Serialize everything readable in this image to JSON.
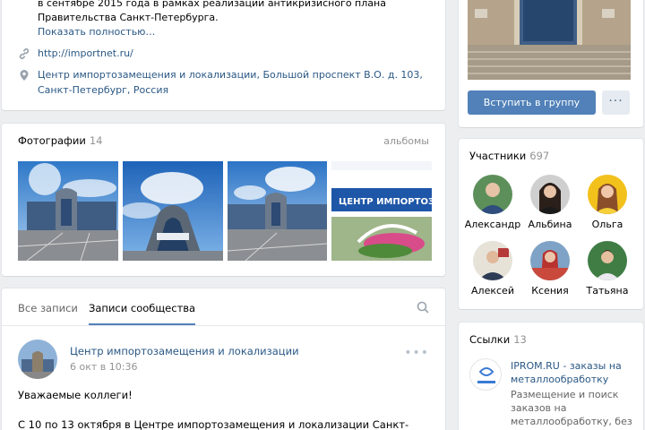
{
  "info": {
    "description_line1": "в сентябре 2015 года в рамках реализации антикризисного плана",
    "description_line2": "Правительства Санкт-Петербурга.",
    "show_more": "Показать полностью…",
    "website": "http://importnet.ru/",
    "address_line1": "Центр импортозамещения и локализации, Большой проспект В.О. д. 103,",
    "address_line2": "Санкт-Петербург, Россия"
  },
  "photos": {
    "title": "Фотографии",
    "count": "14",
    "albums_link": "альбомы",
    "banner_text": "ЦЕНТР ИМПОРТОЗАМЕЩЕНИЯ"
  },
  "feed": {
    "tab_all": "Все записи",
    "tab_community": "Записи сообщества",
    "post": {
      "author": "Центр импортозамещения и локализации",
      "date": "6 окт в 10:36",
      "line1": "Уважаемые коллеги!",
      "line2": "С 10 по 13 октября в Центре импортозамещения и локализации Санкт-"
    }
  },
  "group": {
    "join_button": "Вступить в группу",
    "more_button": "···"
  },
  "members": {
    "title": "Участники",
    "count": "697",
    "people": [
      {
        "name": "Александр"
      },
      {
        "name": "Альбина"
      },
      {
        "name": "Ольга"
      },
      {
        "name": "Алексей"
      },
      {
        "name": "Ксения"
      },
      {
        "name": "Татьяна"
      }
    ]
  },
  "links": {
    "title": "Ссылки",
    "count": "13",
    "item": {
      "title_line1": "IPROM.RU - заказы на",
      "title_line2": "металлообработку",
      "desc_line1": "Размещение и поиск",
      "desc_line2": "заказов на",
      "desc_line3": "металлообработку, без"
    }
  },
  "colors": {
    "accent": "#5181b8",
    "link": "#2a5885",
    "background": "#edeef0"
  }
}
